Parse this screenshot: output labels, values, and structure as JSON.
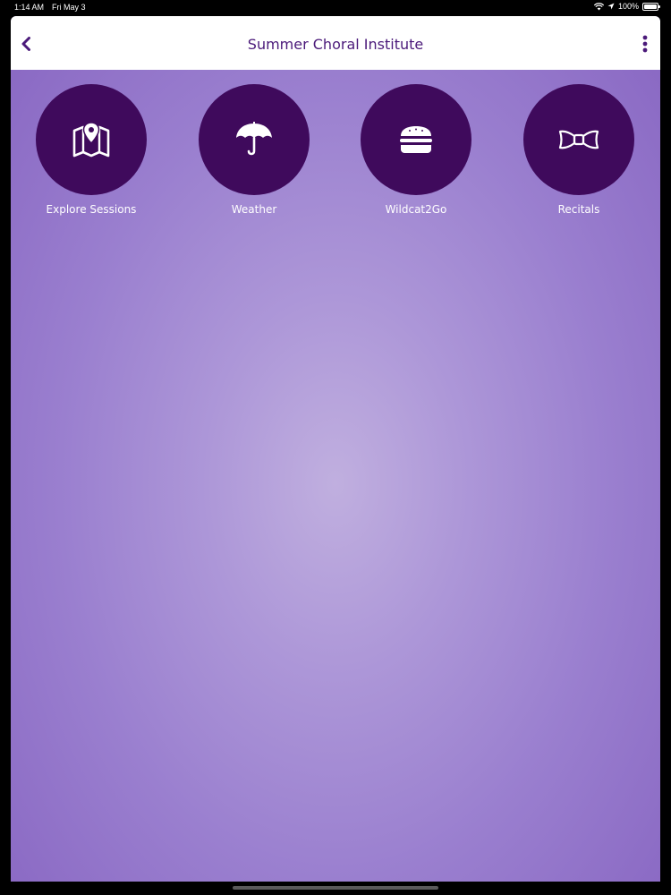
{
  "status_bar": {
    "time": "1:14 AM",
    "date": "Fri May 3",
    "battery": "100%"
  },
  "header": {
    "title": "Summer Choral Institute",
    "back_icon": "chevron-left-icon",
    "more_icon": "more-vertical-icon"
  },
  "tiles": [
    {
      "label": "Explore Sessions",
      "icon": "map-pin-icon"
    },
    {
      "label": "Weather",
      "icon": "umbrella-icon"
    },
    {
      "label": "Wildcat2Go",
      "icon": "burger-icon"
    },
    {
      "label": "Recitals",
      "icon": "bow-tie-icon"
    }
  ],
  "colors": {
    "accent": "#4b1a7a",
    "tile": "#3f0a5c",
    "background_center": "#c0afdf",
    "background_edge": "#8866c2"
  }
}
